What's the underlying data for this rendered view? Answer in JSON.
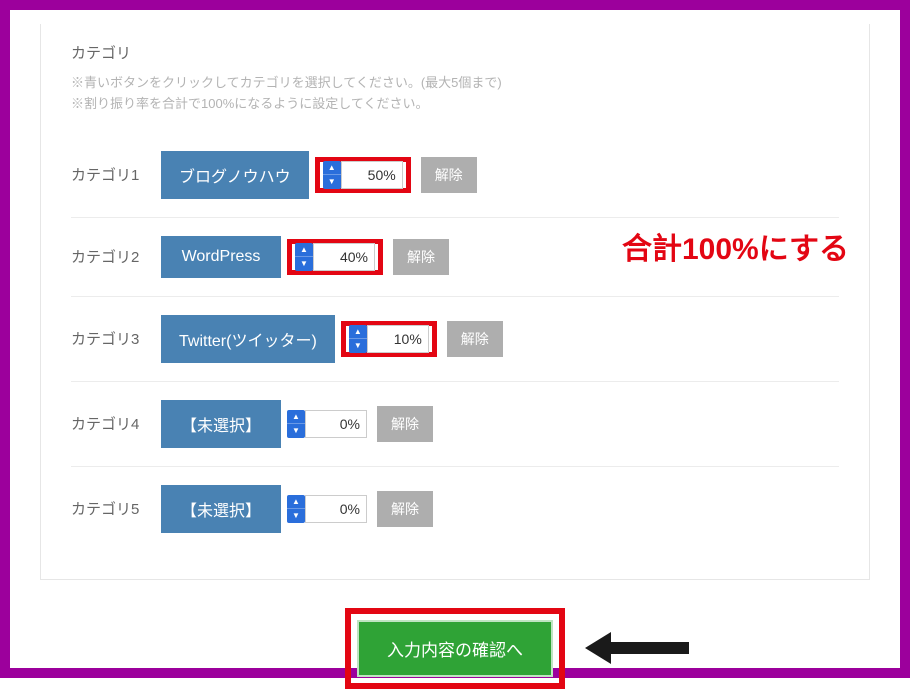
{
  "section": {
    "title": "カテゴリ",
    "hint1": "※青いボタンをクリックしてカテゴリを選択してください。(最大5個まで)",
    "hint2": "※割り振り率を合計で100%になるように設定してください。"
  },
  "rows": [
    {
      "label": "カテゴリ1",
      "category": "ブログノウハウ",
      "percent": "50%",
      "release": "解除",
      "highlight": true
    },
    {
      "label": "カテゴリ2",
      "category": "WordPress",
      "percent": "40%",
      "release": "解除",
      "highlight": true
    },
    {
      "label": "カテゴリ3",
      "category": "Twitter(ツイッター)",
      "percent": "10%",
      "release": "解除",
      "highlight": true
    },
    {
      "label": "カテゴリ4",
      "category": "【未選択】",
      "percent": "0%",
      "release": "解除",
      "highlight": false
    },
    {
      "label": "カテゴリ5",
      "category": "【未選択】",
      "percent": "0%",
      "release": "解除",
      "highlight": false
    }
  ],
  "annotation": {
    "sum_text": "合計100%にする"
  },
  "submit": {
    "label": "入力内容の確認へ"
  }
}
